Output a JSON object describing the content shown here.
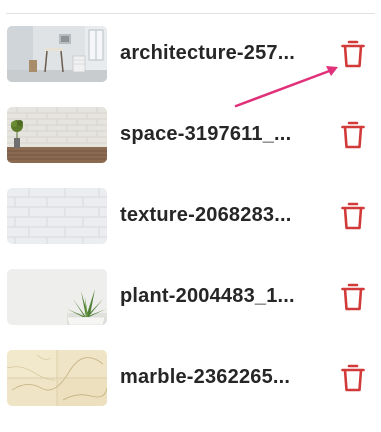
{
  "files": [
    {
      "name": "architecture-257...",
      "thumbnail": "room-interior"
    },
    {
      "name": "space-3197611_...",
      "thumbnail": "white-brick-wall-plant"
    },
    {
      "name": "texture-2068283...",
      "thumbnail": "white-brick-texture"
    },
    {
      "name": "plant-2004483_1...",
      "thumbnail": "succulent-plant"
    },
    {
      "name": "marble-2362265...",
      "thumbnail": "marble-tiles"
    }
  ],
  "icons": {
    "delete": "trash-icon"
  },
  "colors": {
    "delete_icon": "#d23a3a",
    "annotation_arrow": "#e0307a",
    "text": "#262626",
    "divider": "#e2e2e2"
  }
}
